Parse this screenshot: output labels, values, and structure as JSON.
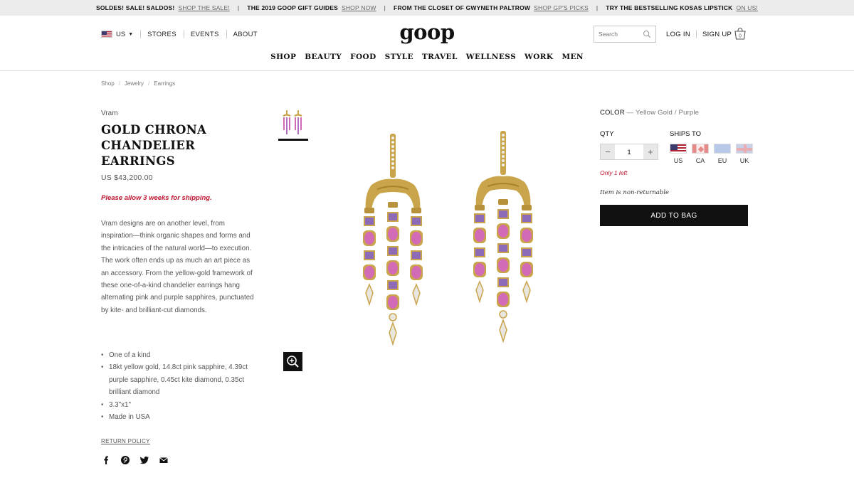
{
  "promo": {
    "items": [
      {
        "text": "SOLDES! SALE! SALDOS!",
        "link": "SHOP THE SALE!"
      },
      {
        "text": "THE 2019 GOOP GIFT GUIDES",
        "link": "SHOP NOW"
      },
      {
        "text": "FROM THE CLOSET OF GWYNETH PALTROW",
        "link": "SHOP GP'S PICKS"
      },
      {
        "text": "TRY THE BESTSELLING KOSAS LIPSTICK",
        "link": "ON US!"
      }
    ],
    "separator": "|"
  },
  "header": {
    "country": "US",
    "util_links": [
      "STORES",
      "EVENTS",
      "ABOUT"
    ],
    "logo": "goop",
    "search_placeholder": "Search",
    "login": "LOG IN",
    "signup": "SIGN UP",
    "bag_count": "0",
    "nav": [
      "SHOP",
      "BEAUTY",
      "FOOD",
      "STYLE",
      "TRAVEL",
      "WELLNESS",
      "WORK",
      "MEN"
    ]
  },
  "breadcrumb": [
    "Shop",
    "Jewelry",
    "Earrings"
  ],
  "product": {
    "brand": "Vram",
    "title": "GOLD CHRONA CHANDELIER EARRINGS",
    "price": "US $43,200.00",
    "shipping_note": "Please allow 3 weeks for shipping.",
    "description": "Vram designs are on another level, from inspiration—think organic shapes and forms and the intricacies of the natural world—to execution. The work often ends up as much an art piece as an accessory. From the yellow-gold framework of these one-of-a-kind chandelier earrings hang alternating pink and purple sapphires, punctuated by kite- and brilliant-cut diamonds.",
    "bullets": [
      "One of a kind",
      "18kt yellow gold, 14.8ct pink sapphire, 4.39ct purple sapphire, 0.45ct kite diamond, 0.35ct brilliant diamond",
      "3.3\"x1\"",
      "Made in USA"
    ],
    "return_policy": "RETURN POLICY",
    "color_label": "COLOR",
    "color_value": "— Yellow Gold / Purple",
    "qty_label": "QTY",
    "qty_value": "1",
    "ships_label": "SHIPS TO",
    "ships_to": [
      "US",
      "CA",
      "EU",
      "UK"
    ],
    "stock_note": "Only 1 left",
    "nonreturn": "Item is non-returnable",
    "add_to_bag": "ADD TO BAG"
  },
  "colors": {
    "gold": "#c9a44a",
    "pink": "#d36ab5",
    "purple": "#8d6ab8",
    "sale_red": "#c0152f"
  }
}
